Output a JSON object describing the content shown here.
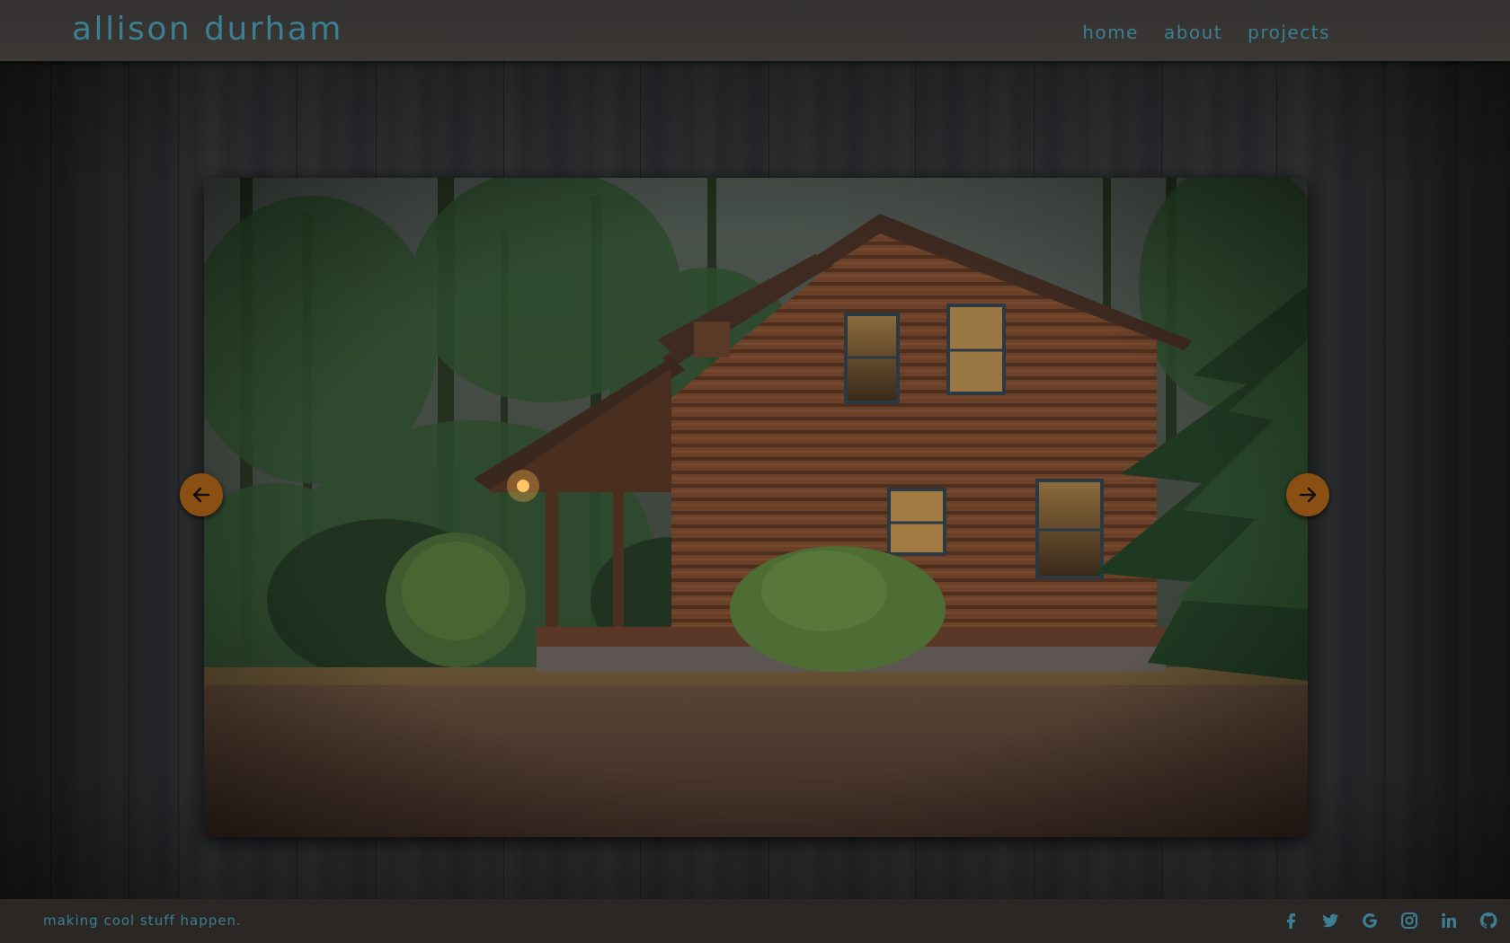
{
  "header": {
    "title": "allison durham",
    "nav": [
      {
        "label": "home"
      },
      {
        "label": "about"
      },
      {
        "label": "projects"
      }
    ]
  },
  "slider": {
    "prev_icon": "arrow-left-icon",
    "next_icon": "arrow-right-icon"
  },
  "footer": {
    "tagline": "making cool stuff happen.",
    "social": [
      {
        "icon": "facebook-icon"
      },
      {
        "icon": "twitter-icon"
      },
      {
        "icon": "google-icon"
      },
      {
        "icon": "instagram-icon"
      },
      {
        "icon": "linkedin-icon"
      },
      {
        "icon": "github-icon"
      }
    ]
  },
  "colors": {
    "accent": "#3c7f93",
    "arrow": "#8a4f12",
    "header_bg": "#3b3835",
    "footer_bg": "#2a2725"
  }
}
